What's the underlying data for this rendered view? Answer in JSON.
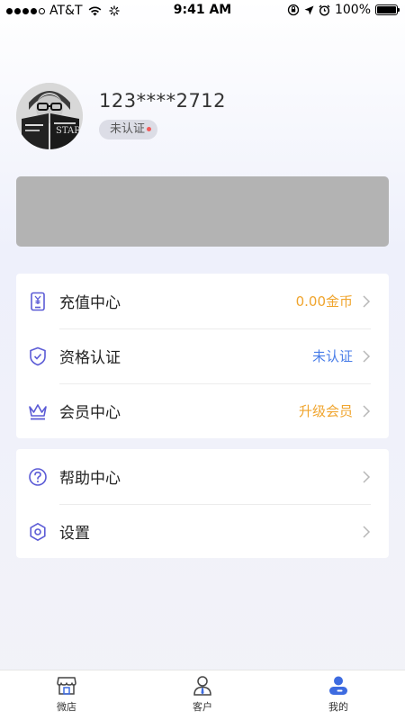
{
  "status_bar": {
    "carrier": "AT&T",
    "time": "9:41 AM",
    "battery": "100%"
  },
  "profile": {
    "phone": "123****2712",
    "cert_status": "未认证"
  },
  "menu_group1": [
    {
      "label": "充值中心",
      "value": "0.00金币",
      "icon": "wallet-phone-icon",
      "value_color": "#f0a52e"
    },
    {
      "label": "资格认证",
      "value": "未认证",
      "icon": "shield-check-icon",
      "value_color": "#4a7ee8"
    },
    {
      "label": "会员中心",
      "value": "升级会员",
      "icon": "crown-icon",
      "value_color": "#f0a52e"
    }
  ],
  "menu_group2": [
    {
      "label": "帮助中心",
      "icon": "help-icon"
    },
    {
      "label": "设置",
      "icon": "settings-icon"
    }
  ],
  "tabs": [
    {
      "label": "微店",
      "icon": "shop-icon"
    },
    {
      "label": "客户",
      "icon": "person-icon"
    },
    {
      "label": "我的",
      "icon": "me-icon",
      "active": true
    }
  ],
  "colors": {
    "accent": "#5b5bd6",
    "orange": "#f0a52e",
    "blue": "#4a7ee8",
    "tab_active": "#3d6be0"
  }
}
